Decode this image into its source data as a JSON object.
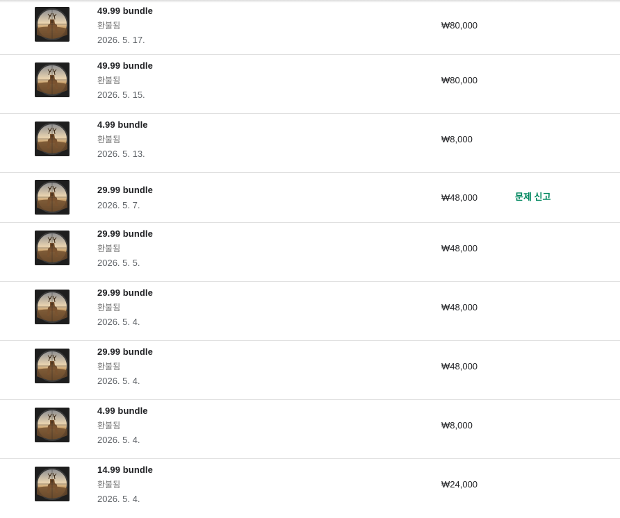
{
  "colors": {
    "accent": "#01875f",
    "divider": "#e0e0e0"
  },
  "app_icon": "deer-hunter-app-icon",
  "orders": [
    {
      "title": "49.99 bundle",
      "status": "환불됨",
      "date": "2026. 5. 17.",
      "price": "₩80,000"
    },
    {
      "title": "49.99 bundle",
      "status": "환불됨",
      "date": "2026. 5. 15.",
      "price": "₩80,000"
    },
    {
      "title": "4.99 bundle",
      "status": "환불됨",
      "date": "2026. 5. 13.",
      "price": "₩8,000"
    },
    {
      "title": "29.99 bundle",
      "date": "2026. 5. 7.",
      "price": "₩48,000",
      "action": "문제 신고"
    },
    {
      "title": "29.99 bundle",
      "status": "환불됨",
      "date": "2026. 5. 5.",
      "price": "₩48,000"
    },
    {
      "title": "29.99 bundle",
      "status": "환불됨",
      "date": "2026. 5. 4.",
      "price": "₩48,000"
    },
    {
      "title": "29.99 bundle",
      "status": "환불됨",
      "date": "2026. 5. 4.",
      "price": "₩48,000"
    },
    {
      "title": "4.99 bundle",
      "status": "환불됨",
      "date": "2026. 5. 4.",
      "price": "₩8,000"
    },
    {
      "title": "14.99 bundle",
      "status": "환불됨",
      "date": "2026. 5. 4.",
      "price": "₩24,000"
    }
  ]
}
